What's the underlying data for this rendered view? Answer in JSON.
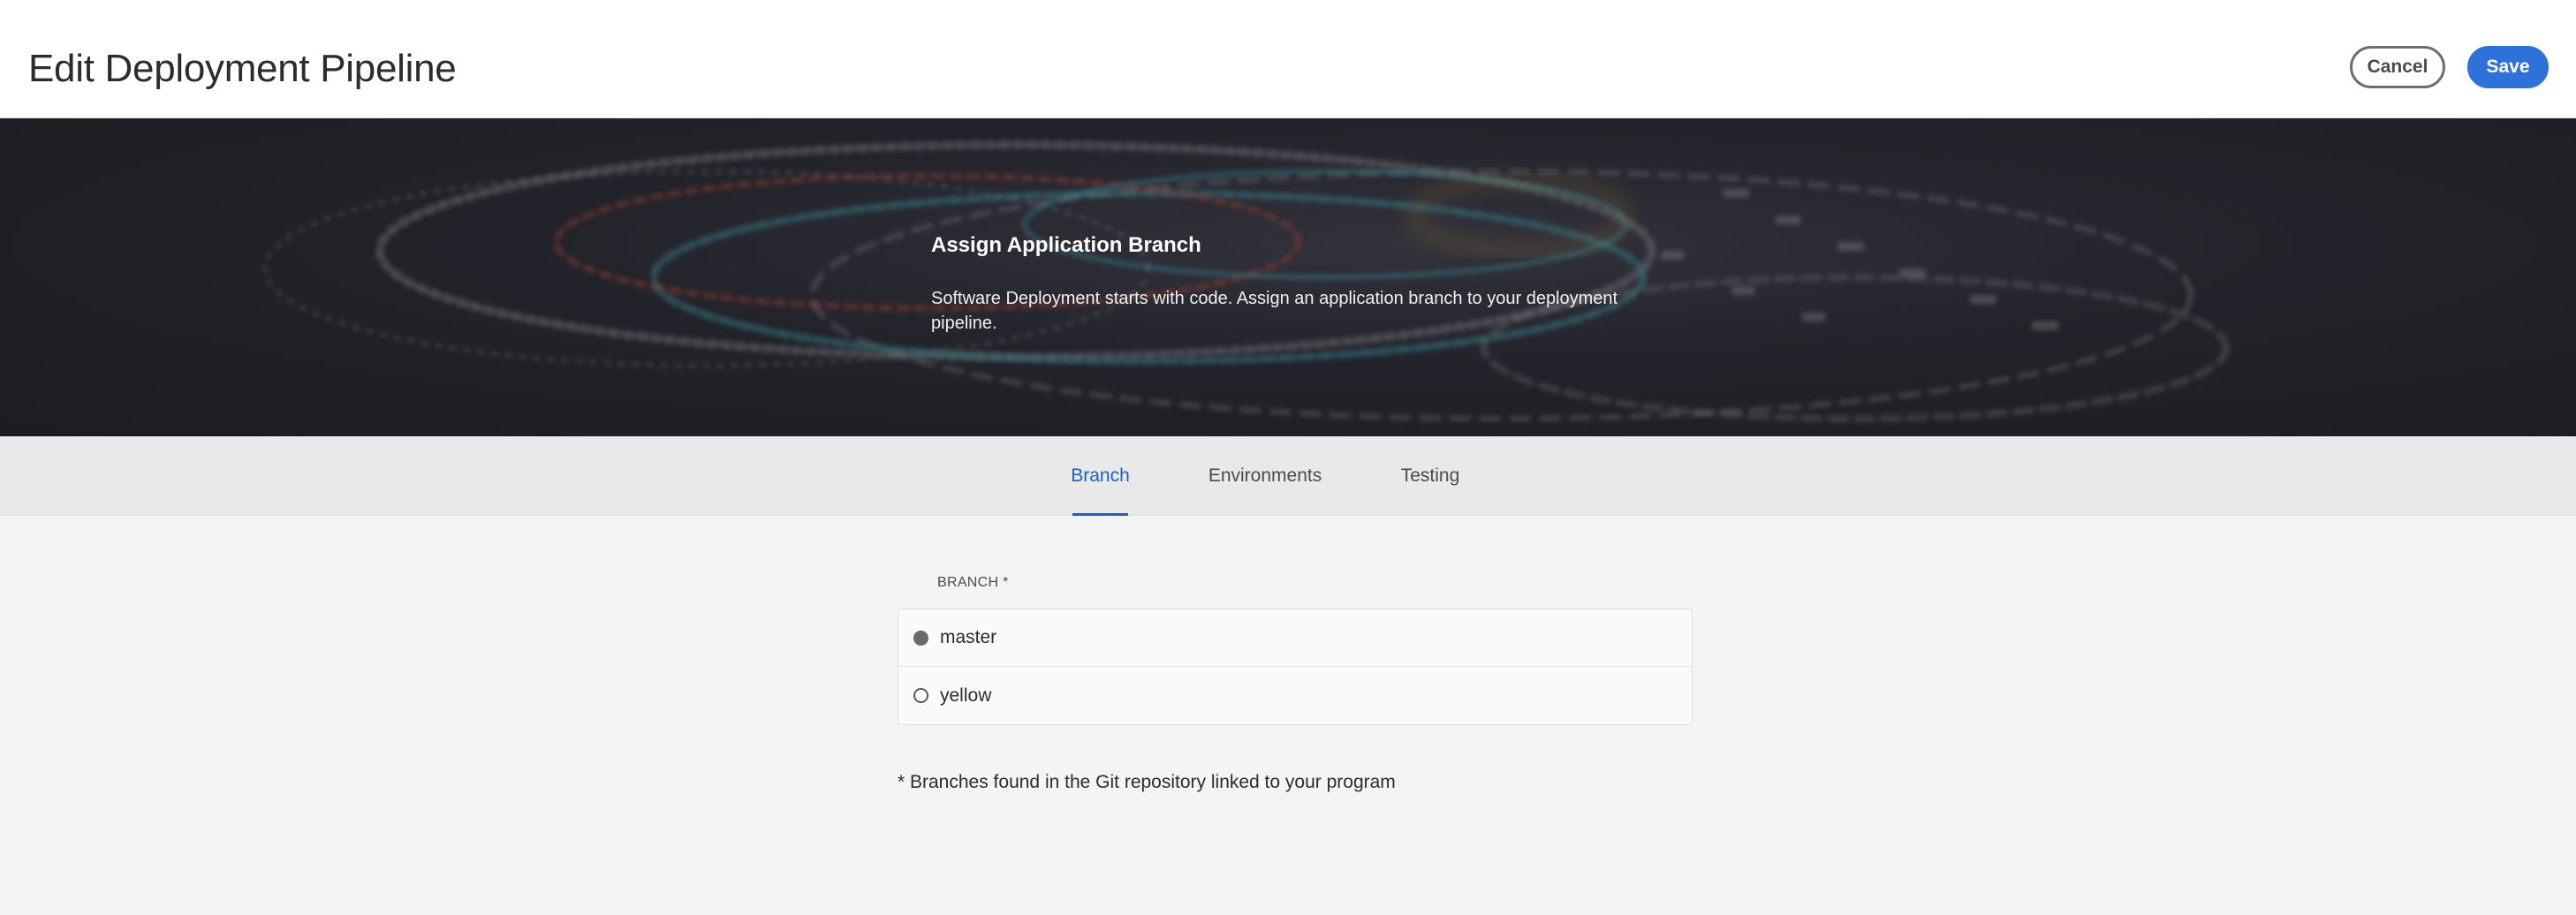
{
  "header": {
    "title": "Edit Deployment Pipeline",
    "cancel_label": "Cancel",
    "save_label": "Save"
  },
  "hero": {
    "title": "Assign Application Branch",
    "description": "Software Deployment starts with code. Assign an application branch to your deployment pipeline."
  },
  "tabs": [
    {
      "label": "Branch",
      "active": true
    },
    {
      "label": "Environments",
      "active": false
    },
    {
      "label": "Testing",
      "active": false
    }
  ],
  "branch_field": {
    "label": "BRANCH *",
    "options": [
      {
        "label": "master",
        "selected": true
      },
      {
        "label": "yellow",
        "selected": false
      }
    ],
    "footnote": "* Branches found in the Git repository linked to your program"
  },
  "colors": {
    "accent": "#2d72d9",
    "active_tab": "#1b5fc9",
    "hero_bg": "#25252c"
  }
}
